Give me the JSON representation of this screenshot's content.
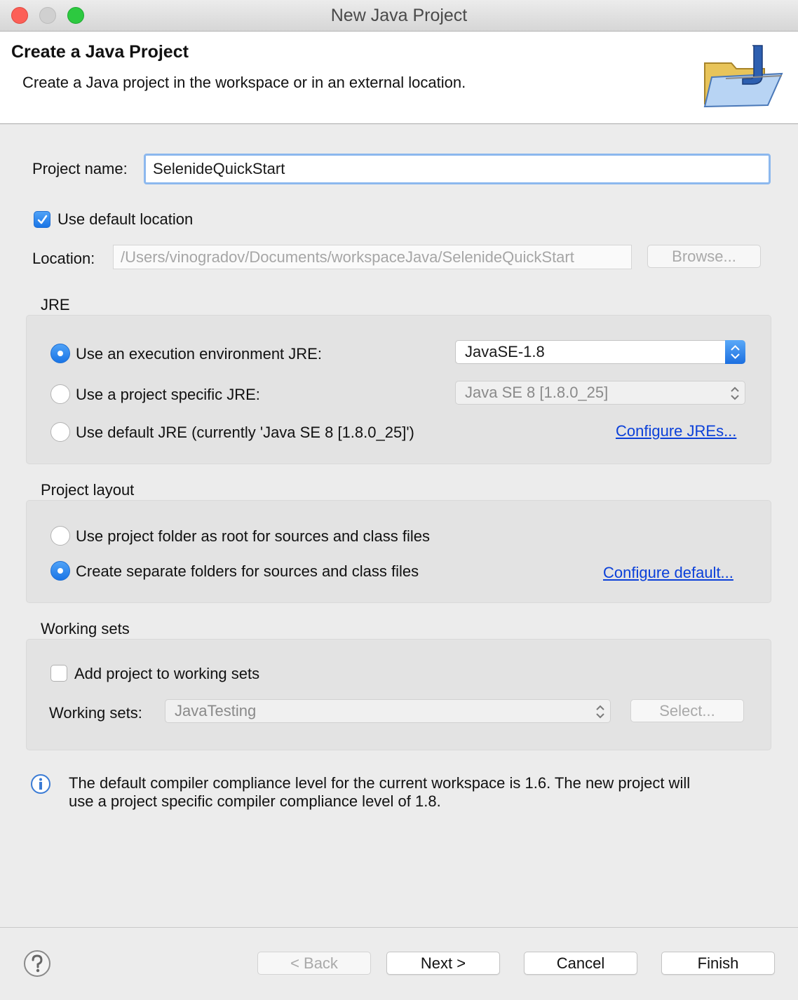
{
  "window": {
    "title": "New Java Project"
  },
  "header": {
    "title": "Create a Java Project",
    "description": "Create a Java project in the workspace or in an external location."
  },
  "project_name": {
    "label": "Project name:",
    "value": "SelenideQuickStart"
  },
  "default_location": {
    "label": "Use default location",
    "checked": true
  },
  "location": {
    "label": "Location:",
    "value": "/Users/vinogradov/Documents/workspaceJava/SelenideQuickStart",
    "browse_label": "Browse..."
  },
  "jre": {
    "section_label": "JRE",
    "option_exec_env": "Use an execution environment JRE:",
    "exec_env_value": "JavaSE-1.8",
    "option_project_specific": "Use a project specific JRE:",
    "project_specific_value": "Java SE 8 [1.8.0_25]",
    "option_default": "Use default JRE (currently 'Java SE 8 [1.8.0_25]')",
    "configure_link": "Configure JREs...",
    "selected": "exec_env"
  },
  "layout": {
    "section_label": "Project layout",
    "option_root": "Use project folder as root for sources and class files",
    "option_separate": "Create separate folders for sources and class files",
    "configure_link": "Configure default...",
    "selected": "separate"
  },
  "working_sets": {
    "section_label": "Working sets",
    "add_label": "Add project to working sets",
    "add_checked": false,
    "sets_label": "Working sets:",
    "sets_value": "JavaTesting",
    "select_label": "Select..."
  },
  "info": {
    "line1": "The default compiler compliance level for the current workspace is 1.6. The new project will",
    "line2": "use a project specific compiler compliance level of 1.8."
  },
  "buttons": {
    "back": "< Back",
    "next": "Next >",
    "cancel": "Cancel",
    "finish": "Finish"
  },
  "icons": {
    "help": "help-icon",
    "info": "info-icon",
    "wizard": "java-project-folder-icon",
    "check": "checkmark-icon"
  },
  "colors": {
    "accent": "#1a75e6",
    "link": "#0b40d9",
    "focus_ring": "#8cb8ee"
  }
}
